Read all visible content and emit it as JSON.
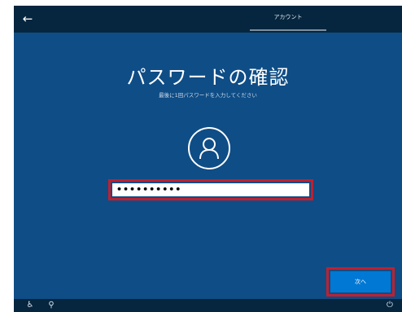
{
  "header": {
    "back_icon": "←",
    "tab_label": "アカウント"
  },
  "main": {
    "title": "パスワードの確認",
    "subtitle": "最後に1回パスワードを入力してください",
    "avatar_icon": "user-icon",
    "password_value": "••••••••••"
  },
  "footer": {
    "next_label": "次へ",
    "left_icons": [
      "ease-of-access-icon",
      "accessibility-icon"
    ],
    "right_icon": "power-icon"
  },
  "colors": {
    "background": "#0f4d86",
    "bar": "#06263f",
    "accent": "#0078d4",
    "highlight": "#c0202f"
  }
}
